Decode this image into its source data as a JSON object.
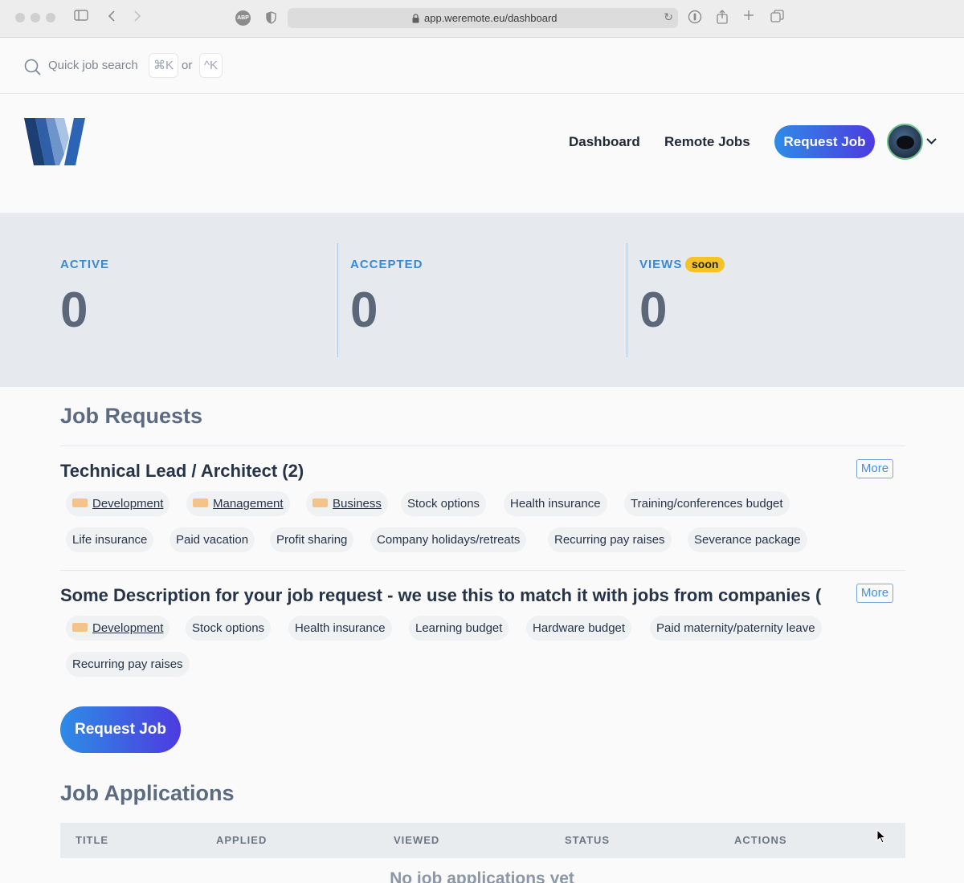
{
  "browser": {
    "url": "app.weremote.eu/dashboard",
    "icons": [
      "sidebar-icon",
      "back-icon",
      "forward-icon",
      "adblock-icon",
      "shield-icon",
      "lock-icon",
      "reload-icon",
      "password-icon",
      "share-icon",
      "new-tab-icon",
      "tabs-icon"
    ],
    "abp_label": "ABP"
  },
  "quick_search": {
    "label": "Quick job search",
    "shortcut_mac": "⌘K",
    "or": "or",
    "shortcut_other": "^K"
  },
  "nav": {
    "dashboard": "Dashboard",
    "remote_jobs": "Remote Jobs",
    "request_job": "Request Job"
  },
  "stats": {
    "active": {
      "label": "ACTIVE",
      "value": "0"
    },
    "accepted": {
      "label": "ACCEPTED",
      "value": "0"
    },
    "views": {
      "label": "VIEWS",
      "value": "0",
      "badge": "soon"
    }
  },
  "job_requests": {
    "title": "Job Requests",
    "items": [
      {
        "title": "Technical Lead / Architect (2)",
        "more": "More",
        "tags": [
          "Development",
          "Management",
          "Business",
          "Stock options",
          "Health insurance",
          "Training/conferences budget",
          "Life insurance",
          "Paid vacation",
          "Profit sharing",
          "Company holidays/retreats",
          "Recurring pay raises",
          "Severance package"
        ]
      },
      {
        "title": "Some Description for your job request - we use this to match it with jobs from companies (",
        "more": "More",
        "tags": [
          "Development",
          "Stock options",
          "Health insurance",
          "Learning budget",
          "Hardware budget",
          "Paid maternity/paternity leave",
          "Recurring pay raises"
        ]
      }
    ],
    "request_button": "Request Job"
  },
  "job_applications": {
    "title": "Job Applications",
    "columns": [
      "TITLE",
      "APPLIED",
      "VIEWED",
      "STATUS",
      "ACTIONS"
    ],
    "empty": "No job applications yet"
  },
  "colors": {
    "accent": "#3a8ad1",
    "gradient_start": "#2e8ce6",
    "gradient_end": "#4d3be0",
    "badge": "#f5c325"
  }
}
